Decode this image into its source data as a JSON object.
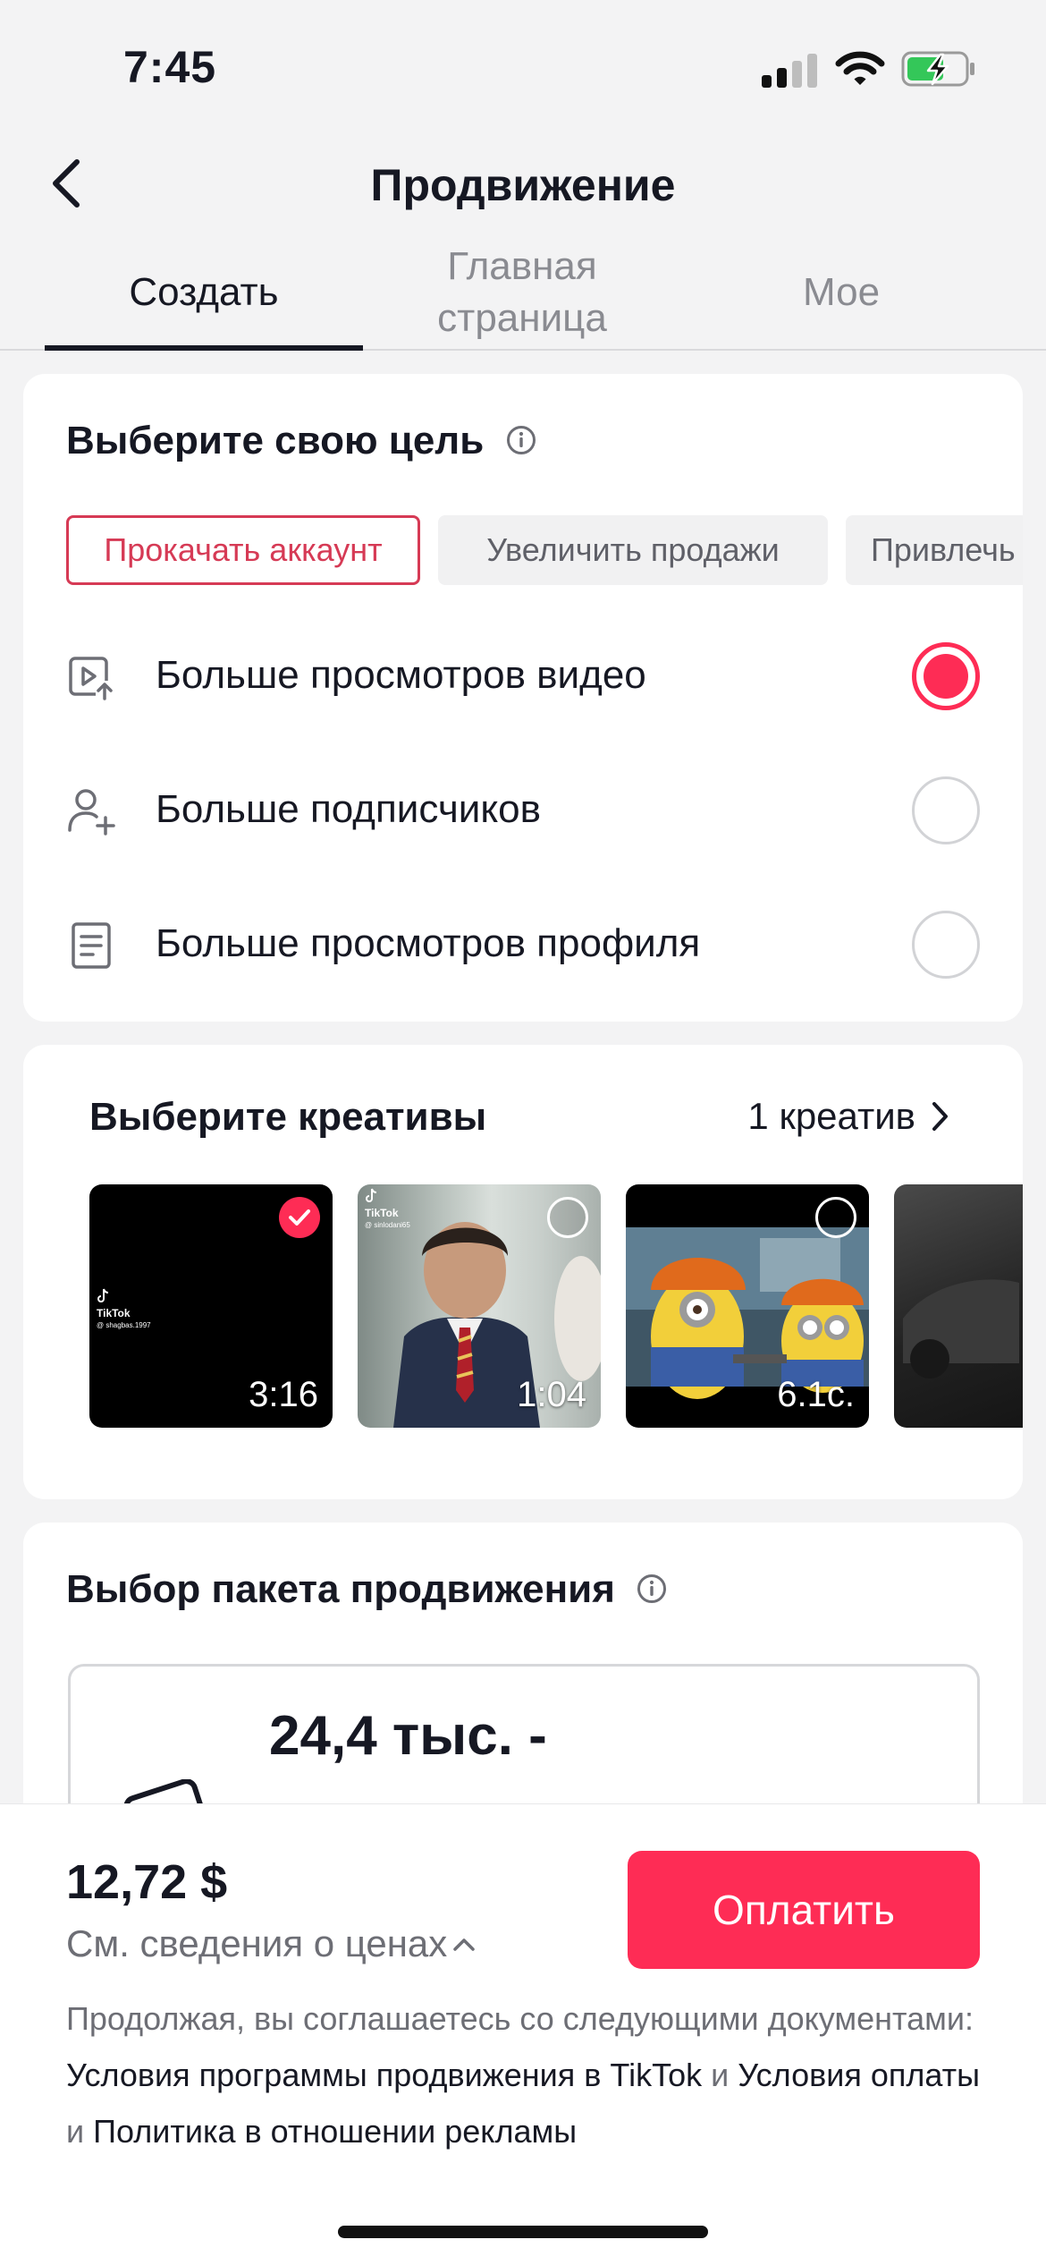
{
  "status_bar": {
    "time": "7:45"
  },
  "header": {
    "title": "Продвижение"
  },
  "tabs": [
    {
      "label": "Создать"
    },
    {
      "label": "Главная страница"
    },
    {
      "label": "Мое"
    }
  ],
  "goal": {
    "title": "Выберите свою цель",
    "chips": [
      {
        "label": "Прокачать аккаунт"
      },
      {
        "label": "Увеличить продажи"
      },
      {
        "label": "Привлечь п"
      }
    ],
    "options": [
      {
        "label": "Больше просмотров видео",
        "icon": "video-views-icon",
        "selected": true
      },
      {
        "label": "Больше подписчиков",
        "icon": "add-follower-icon",
        "selected": false
      },
      {
        "label": "Больше просмотров профиля",
        "icon": "profile-page-icon",
        "selected": false
      }
    ]
  },
  "creatives": {
    "title": "Выберите креативы",
    "count_label": "1 креатив",
    "items": [
      {
        "duration": "3:16",
        "selected": true,
        "watermark": "TikTok",
        "handle": "@ shagbas.1997"
      },
      {
        "duration": "1:04",
        "selected": false,
        "watermark": "TikTok",
        "handle": "@ sinlodani65"
      },
      {
        "duration": "6.1с.",
        "selected": false
      }
    ]
  },
  "package": {
    "title": "Выбор пакета продвижения",
    "reach": "24,4 тыс. -"
  },
  "checkout": {
    "price": "12,72 $",
    "price_details": "См. сведения о ценах",
    "pay_label": "Оплатить",
    "legal_prefix": "Продолжая, вы соглашаетесь со следующими документами: ",
    "link_terms": "Условия программы продвижения в TikTok",
    "and_1": " и ",
    "link_payment": "Условия оплаты",
    "and_2": " и ",
    "link_ads": "Политика в отношении рекламы"
  },
  "colors": {
    "accent": "#fe2c55",
    "chip_border": "#d63a55",
    "background": "#f3f3f4"
  }
}
